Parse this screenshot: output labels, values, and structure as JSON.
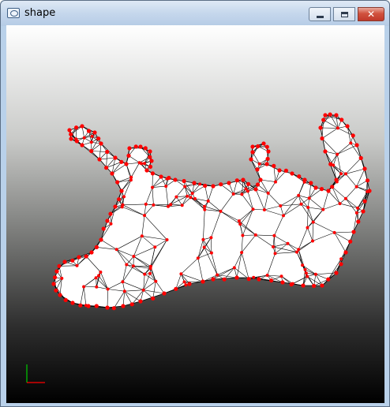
{
  "window": {
    "title": "shape",
    "icon": "opengl-app-icon",
    "controls": [
      "minimize-icon",
      "maximize-icon",
      "close-icon"
    ],
    "close_glyph": "✕"
  },
  "viewport": {
    "background_gradient": [
      "#ffffff",
      "#000000"
    ],
    "mesh": {
      "edge_color": "#000000",
      "fill_color": "#ffffff",
      "vertex_color": "#ff0000"
    },
    "axes_colors": {
      "x": "#ff0000",
      "y": "#00cc00"
    }
  }
}
